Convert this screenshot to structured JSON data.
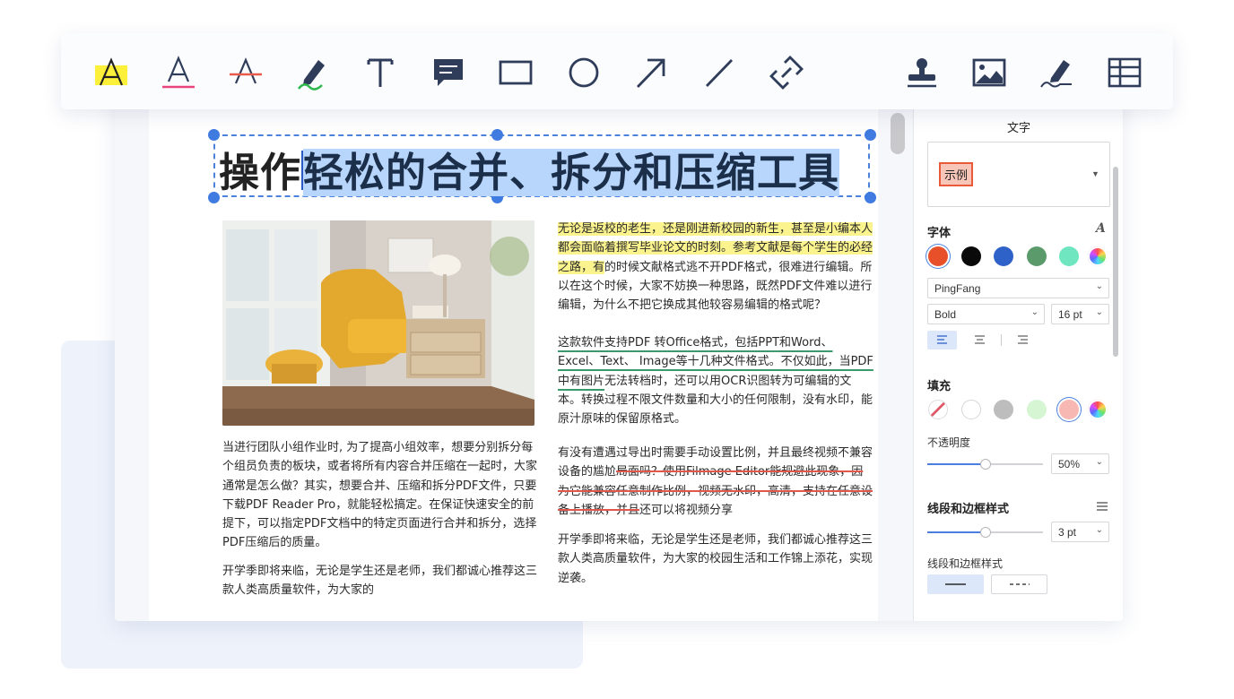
{
  "toolbar": {
    "tools": [
      {
        "name": "highlight-tool",
        "icon": "highlight-text-icon"
      },
      {
        "name": "underline-tool",
        "icon": "underline-text-icon"
      },
      {
        "name": "strikethrough-tool",
        "icon": "strikethrough-text-icon"
      },
      {
        "name": "freehand-tool",
        "icon": "pen-icon"
      },
      {
        "name": "text-tool",
        "icon": "text-icon"
      },
      {
        "name": "note-tool",
        "icon": "comment-icon"
      },
      {
        "name": "rectangle-tool",
        "icon": "rectangle-icon"
      },
      {
        "name": "circle-tool",
        "icon": "circle-icon"
      },
      {
        "name": "arrow-tool",
        "icon": "arrow-icon"
      },
      {
        "name": "line-tool",
        "icon": "line-icon"
      },
      {
        "name": "link-tool",
        "icon": "link-icon"
      },
      {
        "name": "stamp-tool",
        "icon": "stamp-icon"
      },
      {
        "name": "image-tool",
        "icon": "image-icon"
      },
      {
        "name": "signature-tool",
        "icon": "signature-icon"
      },
      {
        "name": "table-tool",
        "icon": "table-icon"
      }
    ]
  },
  "document": {
    "title_plain": "操作",
    "title_selected": "轻松的合并、拆分和压缩工具",
    "left_p1": "当进行团队小组作业时, 为了提高小组效率，想要分别拆分每个组员负责的板块，或者将所有内容合并压缩在一起时，大家通常是怎么做？其实，想要合并、压缩和拆分PDF文件，只要下载PDF Reader Pro，就能轻松搞定。在保证快速安全的前提下，可以指定PDF文档中的特定页面进行合并和拆分，选择PDF压缩后的质量。",
    "left_p2": "开学季即将来临，无论是学生还是老师，我们都诚心推荐这三款人类高质量软件，为大家的",
    "right_p1_hl": "无论是返校的老生，还是刚进新校园的新生，甚至是小编本人都会面临着撰写毕业论文的时刻。参考文献是每个学生的必经之路，有",
    "right_p1_rest": "的时候文献格式逃不开PDF格式，很难进行编辑。所以在这个时候，大家不妨换一种思路，既然PDF文件难以进行编辑，为什么不把它换成其他较容易编辑的格式呢？",
    "right_p2_ul": "这款软件支持PDF 转Office格式，包括PPT和Word、Excel、Text、 Image等十几种文件格式。不仅如此，当PDF中有图片",
    "right_p2_rest": "无法转档时，还可以用OCR识图转为可编辑的文本。转换过程不限文件数量和大小的任何限制，没有水印，能原汁原味的保留原格式。",
    "right_p3_a": "有没有遭遇过导出时需要手动设置比例，并且最终视频不兼容设备的尴尬",
    "right_p3_st": "局面吗？使用Filmage Editor能规避此现象，因为它能兼容任意制作比例，视频无水印，高清，支持在任意设备上播放，并且",
    "right_p3_b": "还可以将视频分享",
    "right_p4": "开学季即将来临，无论是学生还是老师，我们都诚心推荐这三款人类高质量软件，为大家的校园生活和工作锦上添花，实现逆袭。"
  },
  "panel": {
    "header": "文字",
    "sample": "示例",
    "font_section": "字体",
    "font_colors": [
      "#e8502a",
      "#0a0a0a",
      "#2f62c8",
      "#5b9a6a",
      "#6fe6c0"
    ],
    "font_family": "PingFang",
    "font_weight": "Bold",
    "font_size": "16 pt",
    "fill_section": "填充",
    "fill_colors": [
      "none",
      "#ffffff",
      "#bdbdbd",
      "#d6f5d2",
      "#f7b8b4"
    ],
    "opacity_label": "不透明度",
    "opacity_value": "50%",
    "opacity_level": 0.5,
    "line_section": "线段和边框样式",
    "line_width": "3 pt",
    "line_width_level": 0.5,
    "line_style_label": "线段和边框样式",
    "line_styles": [
      "solid",
      "dashed"
    ]
  }
}
